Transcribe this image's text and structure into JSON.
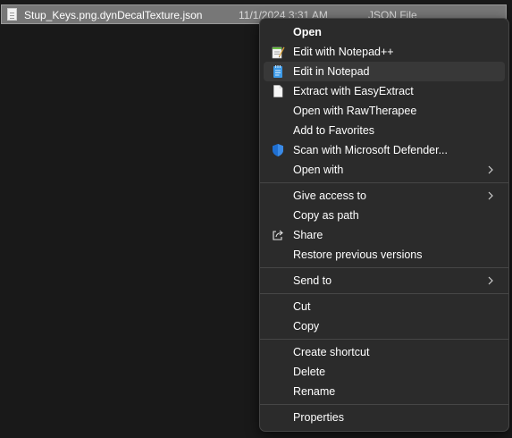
{
  "file": {
    "name": "Stup_Keys.png.dynDecalTexture.json",
    "date": "11/1/2024 3:31 AM",
    "type": "JSON File"
  },
  "menu": {
    "open": "Open",
    "edit_notepadpp": "Edit with Notepad++",
    "edit_notepad": "Edit in Notepad",
    "extract_easyextract": "Extract with EasyExtract",
    "open_rawtherapee": "Open with RawTherapee",
    "add_favorites": "Add to Favorites",
    "scan_defender": "Scan with Microsoft Defender...",
    "open_with": "Open with",
    "give_access": "Give access to",
    "copy_path": "Copy as path",
    "share": "Share",
    "restore_versions": "Restore previous versions",
    "send_to": "Send to",
    "cut": "Cut",
    "copy": "Copy",
    "create_shortcut": "Create shortcut",
    "delete": "Delete",
    "rename": "Rename",
    "properties": "Properties"
  },
  "icons": {
    "notepadpp": "notepadpp-icon",
    "notepad": "notepad-icon",
    "document": "document-icon",
    "defender": "defender-shield-icon",
    "share": "share-icon",
    "submenu": "chevron-right-icon"
  },
  "colors": {
    "menu_bg": "#2b2b2b",
    "hover_bg": "#383838",
    "selection_bg": "#777777",
    "defender_blue": "#1f6fd1"
  }
}
